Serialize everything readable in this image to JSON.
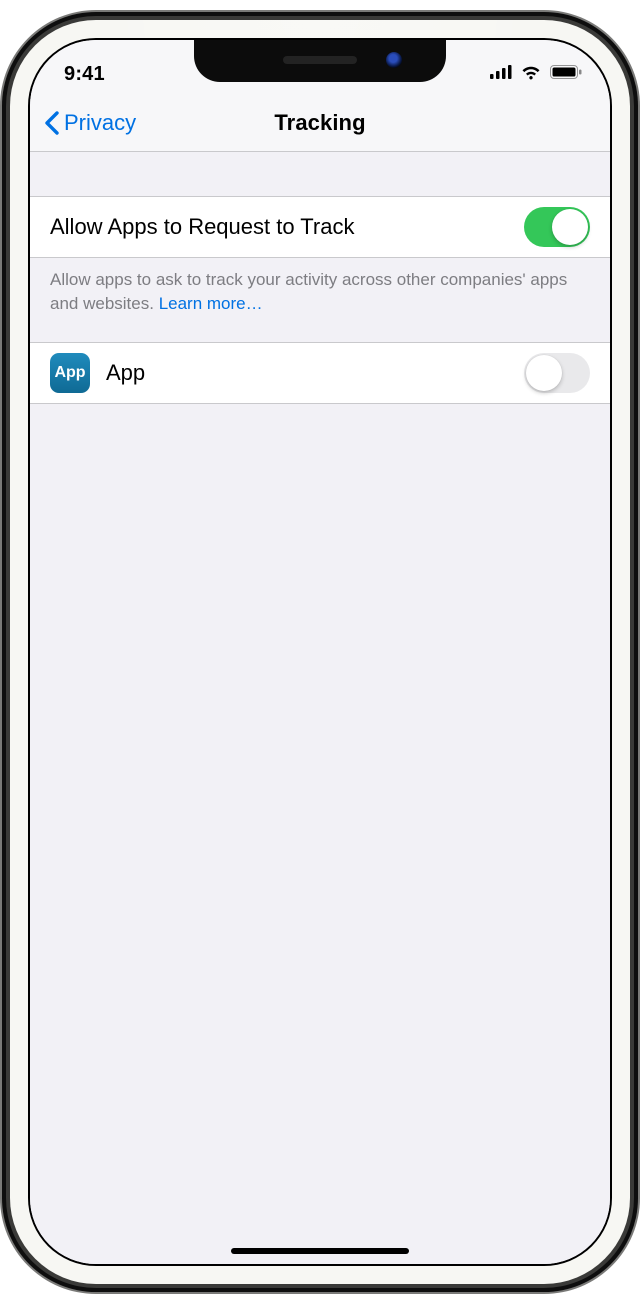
{
  "statusbar": {
    "time": "9:41"
  },
  "navbar": {
    "back_label": "Privacy",
    "title": "Tracking"
  },
  "allow_tracking": {
    "label": "Allow Apps to Request to Track",
    "enabled": true
  },
  "footer": {
    "text": "Allow apps to ask to track your activity across other companies' apps and websites. ",
    "learn_more": "Learn more…"
  },
  "apps": [
    {
      "name": "App",
      "icon_label": "App",
      "enabled": false
    }
  ]
}
